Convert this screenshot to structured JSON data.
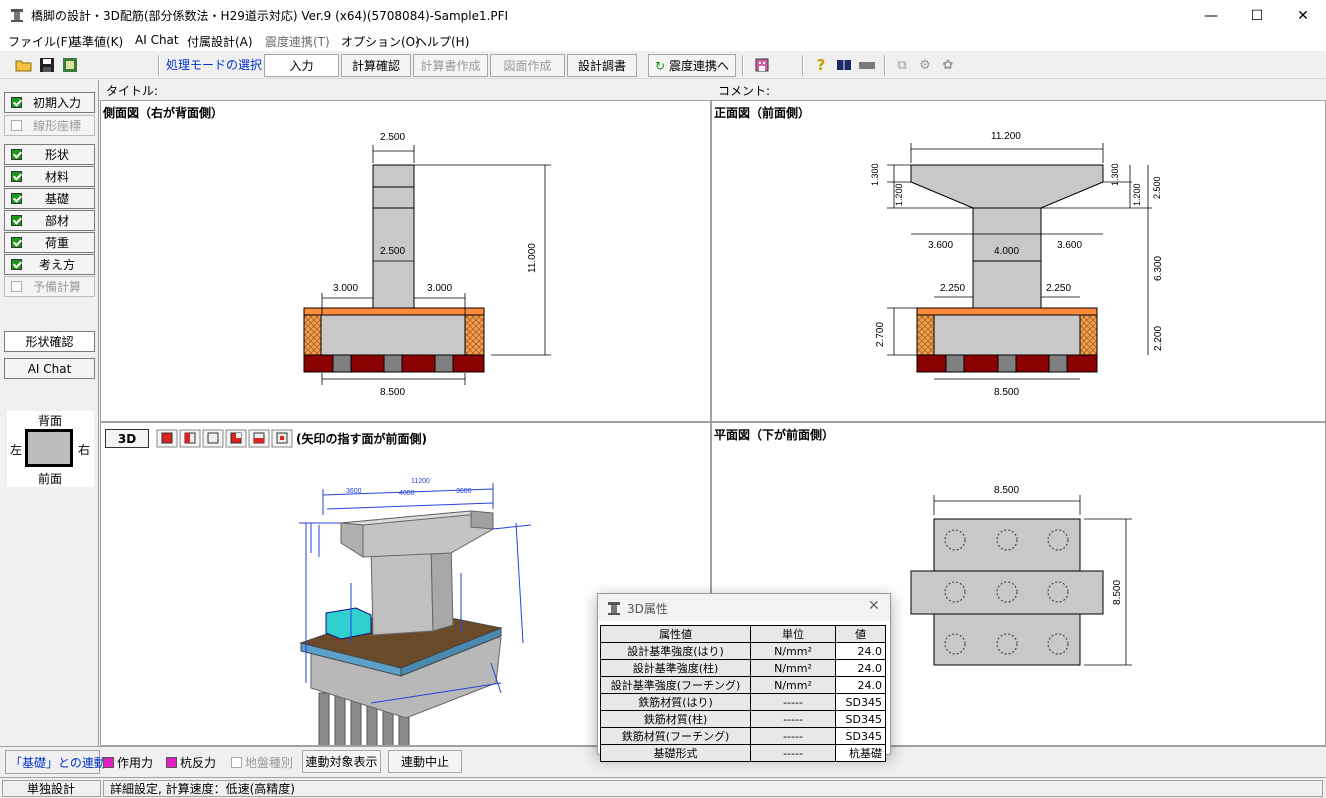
{
  "window": {
    "title": "橋脚の設計・3D配筋(部分係数法・H29道示対応) Ver.9 (x64)(5708084)-Sample1.PFI",
    "min": "—",
    "max": "☐",
    "close": "✕"
  },
  "menu": [
    "ファイル(F)",
    "基準値(K)",
    "AI Chat",
    "付属設計(A)",
    "震度連携(T)",
    "オプション(O)",
    "ヘルプ(H)"
  ],
  "toolbar": {
    "mode_label": "処理モードの選択",
    "input": "入力",
    "calc_check": "計算確認",
    "report": "計算書作成",
    "drawing": "図面作成",
    "design_doc": "設計調書",
    "seismic": "震度連携へ"
  },
  "left": {
    "items": [
      {
        "label": "初期入力",
        "enabled": true
      },
      {
        "label": "線形座標",
        "enabled": false
      },
      {
        "label": "形状",
        "enabled": true
      },
      {
        "label": "材料",
        "enabled": true
      },
      {
        "label": "基礎",
        "enabled": true
      },
      {
        "label": "部材",
        "enabled": true
      },
      {
        "label": "荷重",
        "enabled": true
      },
      {
        "label": "考え方",
        "enabled": true
      },
      {
        "label": "予備計算",
        "enabled": false
      }
    ],
    "shape_check": "形状確認",
    "ai_chat": "AI Chat",
    "orient": {
      "back": "背面",
      "front": "前面",
      "left": "左",
      "right": "右"
    }
  },
  "headers": {
    "title_label": "タイトル:",
    "comment_label": "コメント:"
  },
  "views": {
    "side": {
      "title": "側面図（右が背面側）",
      "dims": {
        "top_w": "2.500",
        "col_w": "2.500",
        "left_off": "3.000",
        "right_off": "3.000",
        "height": "11.000",
        "footing_w": "8.500"
      }
    },
    "front": {
      "title": "正面図（前面側）",
      "dims": {
        "beam_w": "11.200",
        "h1l": "1.300",
        "h2l": "1.200",
        "h1r": "1.300",
        "h2r": "1.200",
        "beam_h": "2.500",
        "cant_l": "3.600",
        "col_w": "4.000",
        "cant_r": "3.600",
        "off_l": "2.250",
        "off_r": "2.250",
        "col_h": "6.300",
        "ft_h_l": "2.700",
        "ft_h_r": "2.200",
        "footing_w": "8.500"
      }
    },
    "plan": {
      "title": "平面図（下が前面側）",
      "dims": {
        "w": "8.500",
        "h": "8.500"
      }
    },
    "three_d": {
      "btn": "3D",
      "note": "(矢印の指す面が前面側)",
      "labels": {
        "w": "11200",
        "a": "3600",
        "b": "4000",
        "c": "3600"
      }
    }
  },
  "popup": {
    "title": "3D属性",
    "close": "✕",
    "headers": [
      "属性値",
      "単位",
      "値"
    ],
    "rows": [
      [
        "設計基準強度(はり)",
        "N/mm²",
        "24.0"
      ],
      [
        "設計基準強度(柱)",
        "N/mm²",
        "24.0"
      ],
      [
        "設計基準強度(フーチング)",
        "N/mm²",
        "24.0"
      ],
      [
        "鉄筋材質(はり)",
        "-----",
        "SD345"
      ],
      [
        "鉄筋材質(柱)",
        "-----",
        "SD345"
      ],
      [
        "鉄筋材質(フーチング)",
        "-----",
        "SD345"
      ],
      [
        "基礎形式",
        "-----",
        "杭基礎"
      ]
    ]
  },
  "bottom": {
    "link_label": "「基礎」との連動",
    "action_force": "作用力",
    "pile_reaction": "杭反力",
    "ground_spring": "地盤種別",
    "show_target": "連動対象表示",
    "stop_link": "連動中止"
  },
  "status": {
    "mode": "単独設計",
    "detail": "詳細設定, 計算速度：低速(高精度)"
  },
  "colors": {
    "concrete": "#c8c8c8",
    "pavement": "#ff8c3c",
    "soil": "#8b0000",
    "hatch": "#e8a040",
    "dim": "#000000"
  }
}
